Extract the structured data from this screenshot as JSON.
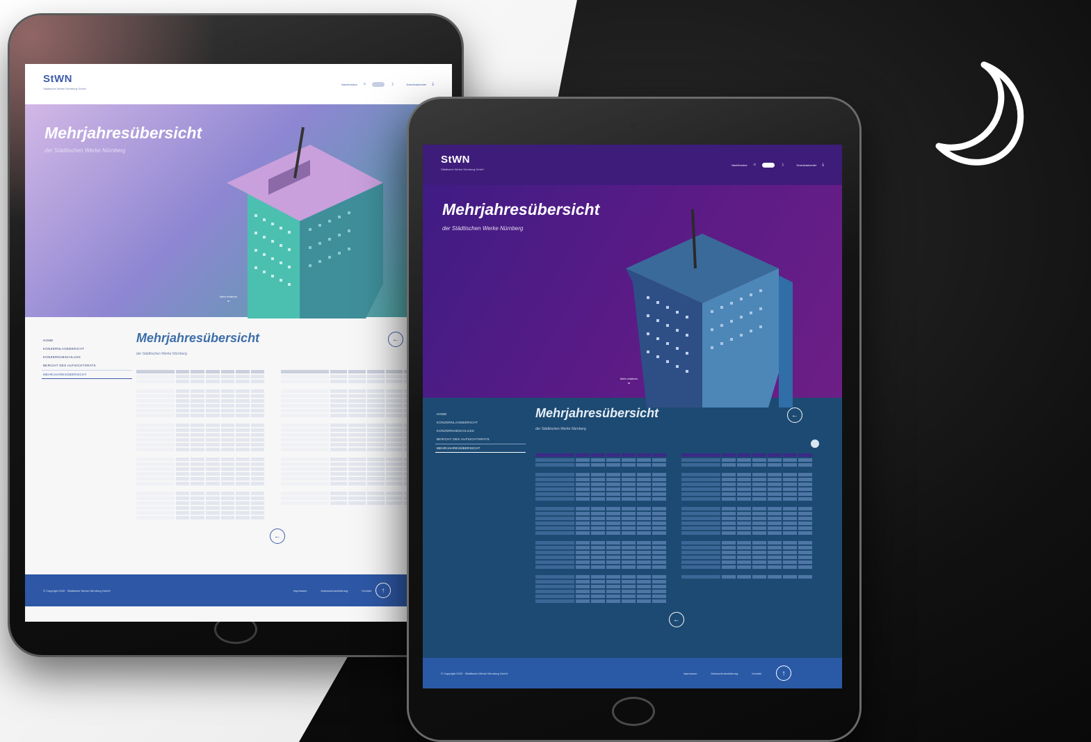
{
  "brand": {
    "logo": "StWN",
    "company": "Städtische Werke Nürnberg GmbH"
  },
  "header": {
    "mode_label": "Nachtmodus",
    "download_label": "Downloadcenter"
  },
  "hero": {
    "title": "Mehrjahresübersicht",
    "subtitle": "der Städtischen Werke Nürnberg",
    "scroll_label": "Mehr erfahren"
  },
  "content": {
    "title": "Mehrjahresübersicht",
    "subtitle": "der Städtischen Werke Nürnberg",
    "back_icon": "arrow-left-icon"
  },
  "nav": {
    "items": [
      {
        "label": "HOME"
      },
      {
        "label": "KONZERNLAGEBERICHT"
      },
      {
        "label": "KONZERNABSCHLUSS"
      },
      {
        "label": "BERICHT DES AUFSICHTSRATS"
      },
      {
        "label": "MEHRJAHRESÜBERSICHT"
      }
    ]
  },
  "footer": {
    "copyright": "© Copyright 2020 · Städtische Werke Nürnberg GmbH",
    "links": [
      "Impressum",
      "Datenschutzerklärung",
      "Kontakt"
    ],
    "up_icon": "arrow-up-icon"
  },
  "theme": {
    "light_accent": "#3c5ca8",
    "dark_accent": "#1f4a74",
    "hero_light_from": "#c6a8dd",
    "hero_light_to": "#3aa59a",
    "hero_dark_from": "#4a1a86",
    "hero_dark_to": "#6a1f86"
  },
  "icons": {
    "moon": "moon-icon"
  }
}
